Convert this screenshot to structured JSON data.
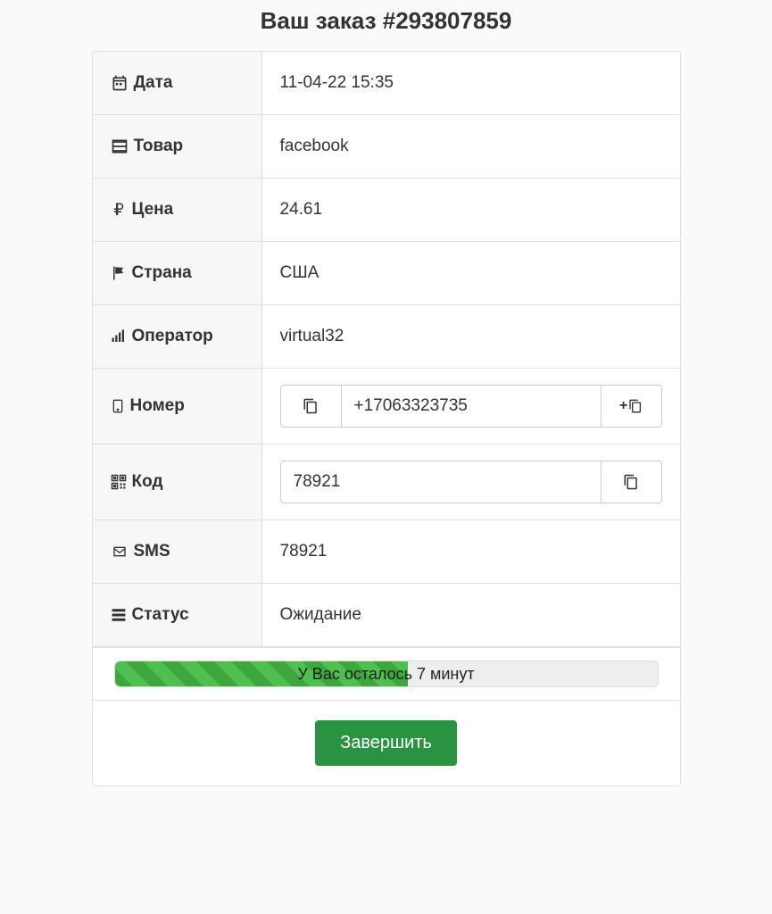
{
  "title": "Ваш заказ #293807859",
  "rows": {
    "date": {
      "label": "Дата",
      "value": "11-04-22 15:35"
    },
    "product": {
      "label": "Товар",
      "value": "facebook"
    },
    "price": {
      "label": "Цена",
      "value": "24.61"
    },
    "country": {
      "label": "Страна",
      "value": "США"
    },
    "operator": {
      "label": "Оператор",
      "value": "virtual32"
    },
    "number": {
      "label": "Номер",
      "value": "+17063323735"
    },
    "code": {
      "label": "Код",
      "value": "78921"
    },
    "sms": {
      "label": "SMS",
      "value": "78921"
    },
    "status": {
      "label": "Статус",
      "value": "Ожидание"
    }
  },
  "progress": {
    "label": "У Вас осталось 7 минут",
    "percent": 54
  },
  "actions": {
    "complete": "Завершить"
  }
}
